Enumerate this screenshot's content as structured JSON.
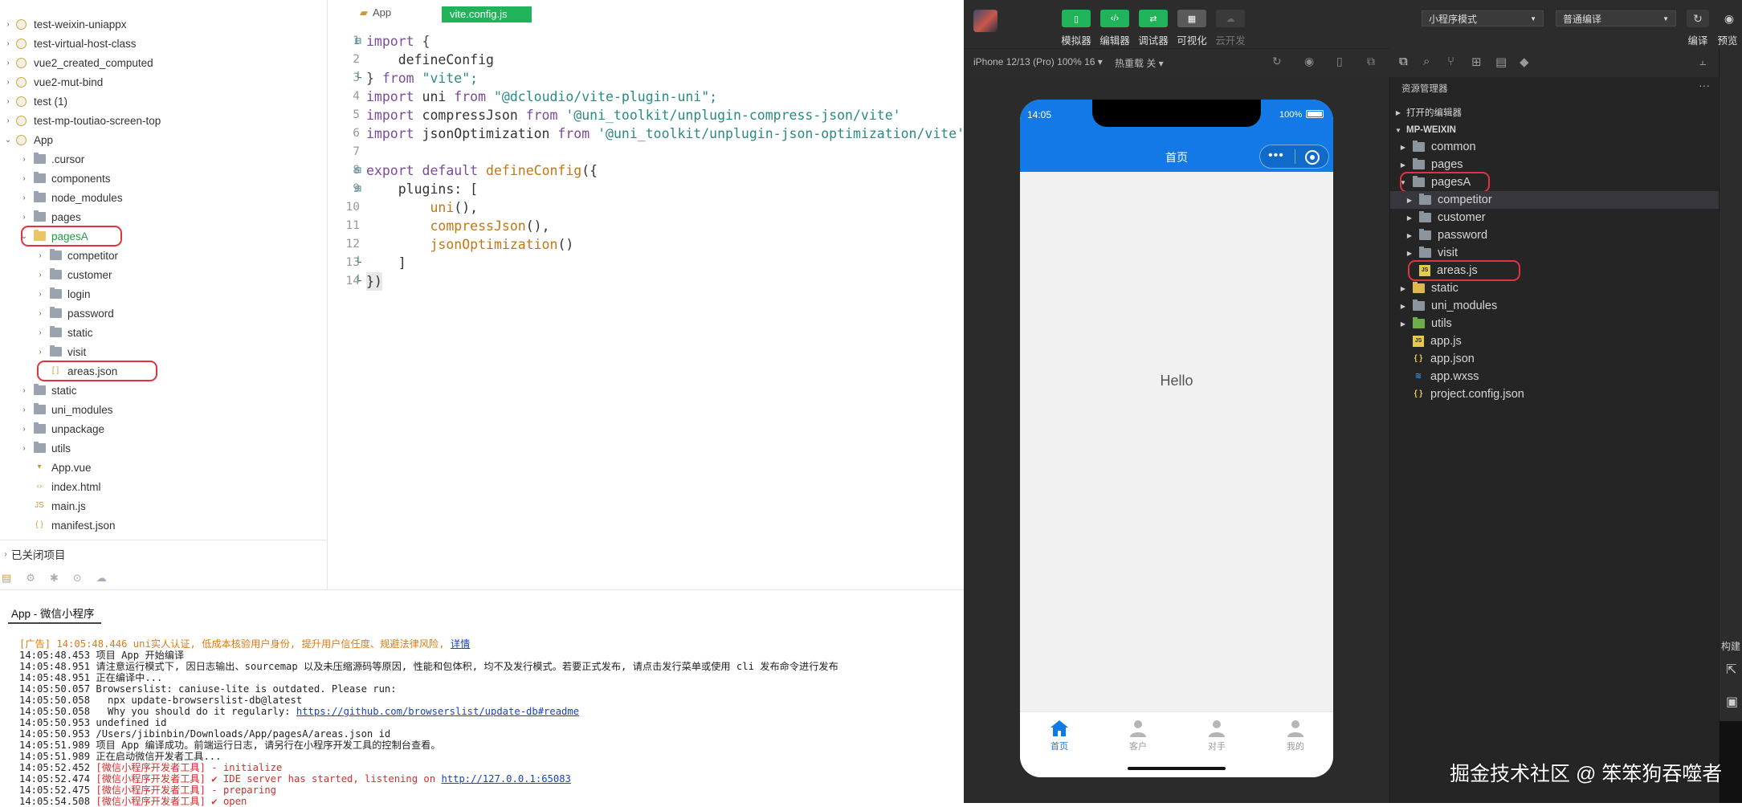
{
  "hbuilder": {
    "tree": [
      {
        "label": "test-weixin-uniappx",
        "type": "project",
        "depth": 0
      },
      {
        "label": "test-virtual-host-class",
        "type": "project",
        "depth": 0
      },
      {
        "label": "vue2_created_computed",
        "type": "project",
        "depth": 0
      },
      {
        "label": "vue2-mut-bind",
        "type": "project",
        "depth": 0
      },
      {
        "label": "test (1)",
        "type": "project",
        "depth": 0
      },
      {
        "label": "test-mp-toutiao-screen-top",
        "type": "project",
        "depth": 0
      },
      {
        "label": "App",
        "type": "project-open",
        "depth": 0
      },
      {
        "label": ".cursor",
        "type": "folder",
        "depth": 1
      },
      {
        "label": "components",
        "type": "folder",
        "depth": 1
      },
      {
        "label": "node_modules",
        "type": "folder",
        "depth": 1
      },
      {
        "label": "pages",
        "type": "folder",
        "depth": 1
      },
      {
        "label": "pagesA",
        "type": "folder-open",
        "depth": 1,
        "highlight": true
      },
      {
        "label": "competitor",
        "type": "folder",
        "depth": 2
      },
      {
        "label": "customer",
        "type": "folder",
        "depth": 2
      },
      {
        "label": "login",
        "type": "folder",
        "depth": 2
      },
      {
        "label": "password",
        "type": "folder",
        "depth": 2
      },
      {
        "label": "static",
        "type": "folder",
        "depth": 2
      },
      {
        "label": "visit",
        "type": "folder",
        "depth": 2
      },
      {
        "label": "areas.json",
        "type": "file-json",
        "depth": 2,
        "highlight": true
      },
      {
        "label": "static",
        "type": "folder",
        "depth": 1
      },
      {
        "label": "uni_modules",
        "type": "folder",
        "depth": 1
      },
      {
        "label": "unpackage",
        "type": "folder",
        "depth": 1
      },
      {
        "label": "utils",
        "type": "folder",
        "depth": 1
      },
      {
        "label": "App.vue",
        "type": "file-vue",
        "depth": 1
      },
      {
        "label": "index.html",
        "type": "file-html",
        "depth": 1
      },
      {
        "label": "main.js",
        "type": "file-js",
        "depth": 1
      },
      {
        "label": "manifest.json",
        "type": "file-json2",
        "depth": 1
      }
    ],
    "closed_projects": "已关闭项目",
    "editor": {
      "breadcrumb": "App",
      "active_tab": "vite.config.js",
      "lines": [
        "1",
        "2",
        "3",
        "4",
        "5",
        "6",
        "7",
        "8",
        "9",
        "10",
        "11",
        "12",
        "13",
        "14"
      ],
      "code": {
        "l1": [
          "import",
          " {"
        ],
        "l2": "    defineConfig",
        "l3": [
          "} ",
          "from",
          " \"vite\";"
        ],
        "l4": [
          "import",
          " uni ",
          "from",
          " \"@dcloudio/vite-plugin-uni\";"
        ],
        "l5": [
          "import",
          " compressJson ",
          "from",
          " '@uni_toolkit/unplugin-compress-json/vite'"
        ],
        "l6": [
          "import",
          " jsonOptimization ",
          "from",
          " '@uni_toolkit/unplugin-json-optimization/vite'"
        ],
        "l8": [
          "export",
          " ",
          "default",
          " ",
          "defineConfig",
          "({"
        ],
        "l9": "    plugins: [",
        "l10": [
          "uni",
          "(),"
        ],
        "l11": [
          "compressJson",
          "(),"
        ],
        "l12": [
          "jsonOptimization",
          "()"
        ],
        "l13": "    ]",
        "l14": "})"
      }
    },
    "console": {
      "tab": "App - 微信小程序",
      "logs": [
        {
          "prefix": "[广告] 14:05:48.446 ",
          "text": "uni实人认证, 低成本核验用户身份, 提升用户信任度、规避法律风险, ",
          "link": "详情",
          "style": "orange"
        },
        {
          "text": "14:05:48.453 项目 App 开始编译"
        },
        {
          "text": "14:05:48.951 请注意运行模式下, 因日志输出、sourcemap 以及未压缩源码等原因, 性能和包体积, 均不及发行模式。若要正式发布, 请点击发行菜单或使用 cli 发布命令进行发布"
        },
        {
          "text": "14:05:48.951 正在编译中..."
        },
        {
          "text": "14:05:50.057 Browserslist: caniuse-lite is outdated. Please run:"
        },
        {
          "text": "14:05:50.058   npx update-browserslist-db@latest"
        },
        {
          "prefix": "14:05:50.058   Why you should do it regularly: ",
          "link": "https://github.com/browserslist/update-db#readme"
        },
        {
          "text": "14:05:50.953 undefined id"
        },
        {
          "text": "14:05:50.953 /Users/jibinbin/Downloads/App/pagesA/areas.json id"
        },
        {
          "text": "14:05:51.989 项目 App 编译成功。前端运行日志, 请另行在小程序开发工具的控制台查看。"
        },
        {
          "text": "14:05:51.989 正在启动微信开发者工具..."
        },
        {
          "prefix": "14:05:52.452 ",
          "text": "[微信小程序开发者工具] - initialize",
          "style": "red"
        },
        {
          "prefix": "14:05:52.474 ",
          "text": "[微信小程序开发者工具] ✔ IDE server has started, listening on ",
          "link": "http://127.0.0.1:65083",
          "style": "red"
        },
        {
          "prefix": "14:05:52.475 ",
          "text": "[微信小程序开发者工具] - preparing",
          "style": "red"
        },
        {
          "prefix": "14:05:54.508 ",
          "text": "[微信小程序开发者工具] ✔ open",
          "style": "red"
        }
      ]
    }
  },
  "wechat": {
    "toolbar": {
      "buttons": [
        "模拟器",
        "编辑器",
        "调试器",
        "可视化",
        "云开发"
      ],
      "mode_select": "小程序模式",
      "compile_select": "普通编译",
      "right_buttons": [
        "编译",
        "预览"
      ]
    },
    "device_bar": {
      "device": "iPhone 12/13 (Pro) 100% 16 ▾",
      "hot_reload": "热重载 关 ▾"
    },
    "phone": {
      "time": "14:05",
      "battery": "100%",
      "nav_title": "首页",
      "content": "Hello",
      "tabs": [
        "首页",
        "客户",
        "对手",
        "我的"
      ]
    },
    "explorer": {
      "title": "资源管理器",
      "open_editors": "打开的编辑器",
      "root": "MP-WEIXIN",
      "items": [
        {
          "label": "common",
          "type": "folder",
          "depth": 1
        },
        {
          "label": "pages",
          "type": "folder",
          "depth": 1
        },
        {
          "label": "pagesA",
          "type": "folder-open",
          "depth": 1,
          "highlight": true
        },
        {
          "label": "competitor",
          "type": "folder",
          "depth": 2,
          "selected": true
        },
        {
          "label": "customer",
          "type": "folder",
          "depth": 2
        },
        {
          "label": "password",
          "type": "folder",
          "depth": 2
        },
        {
          "label": "visit",
          "type": "folder",
          "depth": 2
        },
        {
          "label": "areas.js",
          "type": "file-js",
          "depth": 2,
          "highlight": true
        },
        {
          "label": "static",
          "type": "folder-yellow",
          "depth": 1
        },
        {
          "label": "uni_modules",
          "type": "folder",
          "depth": 1
        },
        {
          "label": "utils",
          "type": "folder-green",
          "depth": 1
        },
        {
          "label": "app.js",
          "type": "file-js",
          "depth": 1
        },
        {
          "label": "app.json",
          "type": "file-json",
          "depth": 1
        },
        {
          "label": "app.wxss",
          "type": "file-wxss",
          "depth": 1
        },
        {
          "label": "project.config.json",
          "type": "file-json",
          "depth": 1
        }
      ]
    },
    "right_strip_label": "构建",
    "watermark": "掘金技术社区 @ 笨笨狗吞噬者"
  },
  "colors": {
    "accent_green": "#20b35a",
    "phone_blue": "#1279e6",
    "highlight_red": "#e0343c"
  }
}
